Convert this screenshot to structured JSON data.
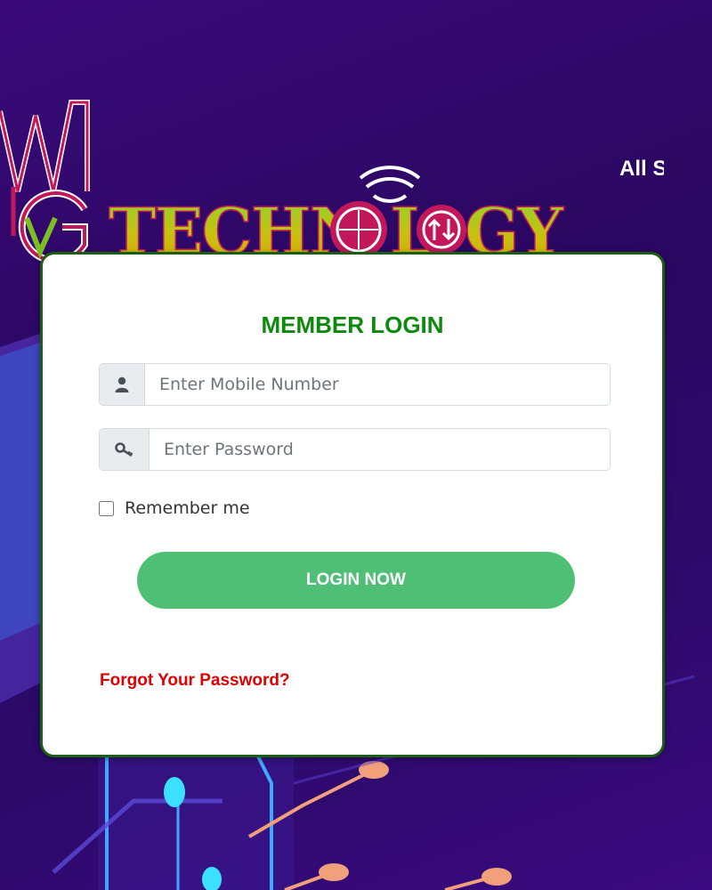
{
  "header": {
    "tagline": "All S"
  },
  "logo": {
    "monogram": "MVG",
    "wordmark": "TECHNOLOGY",
    "colors": {
      "monogram": "#c2185b",
      "wordmark_top": "#7ac020",
      "wordmark_bottom": "#d4b000"
    }
  },
  "login": {
    "title": "MEMBER LOGIN",
    "mobile": {
      "placeholder": "Enter Mobile Number",
      "value": "",
      "icon": "user-icon"
    },
    "password": {
      "placeholder": "Enter Password",
      "value": "",
      "icon": "key-icon"
    },
    "remember_label": "Remember me",
    "remember_checked": false,
    "submit_label": "LOGIN NOW",
    "forgot_label": "Forgot Your Password?"
  },
  "colors": {
    "background": "#2a0760",
    "title": "#0b8a0b",
    "card_border": "#1d5e16",
    "button": "#4fbf75",
    "forgot_link": "#e00000"
  }
}
